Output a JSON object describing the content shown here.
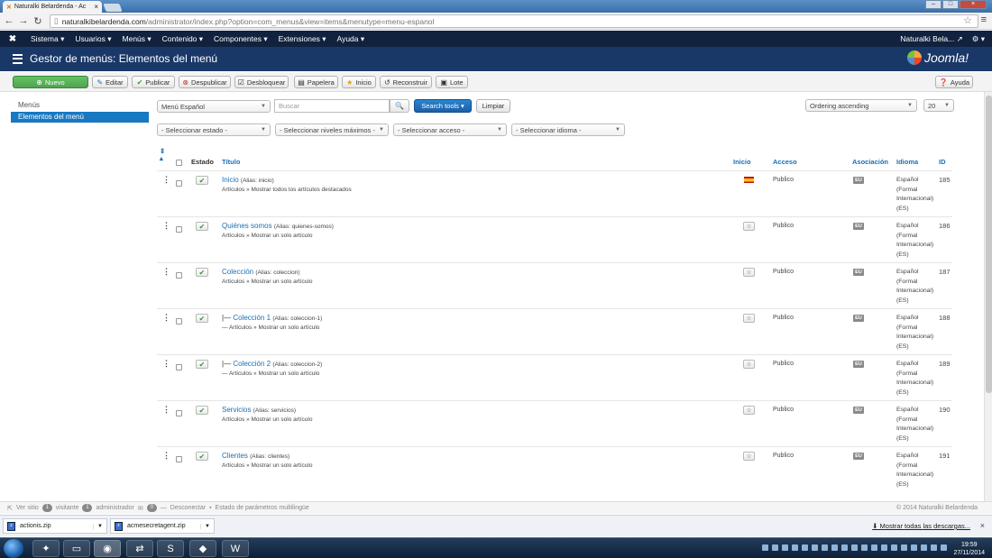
{
  "browser": {
    "tab_title": "Naturalki Belardenda - Ac",
    "url_host": "naturalkibelardenda.com",
    "url_path": "/administrator/index.php?option=com_menus&view=items&menutype=menu-espanol"
  },
  "navbar": {
    "items": [
      "Sistema ▾",
      "Usuarios ▾",
      "Menús ▾",
      "Contenido ▾",
      "Componentes ▾",
      "Extensiones ▾",
      "Ayuda ▾"
    ],
    "site_name": "Naturalki Bela...",
    "ext_icon": "↗",
    "gear": "⚙ ▾"
  },
  "header": {
    "title": "Gestor de menús: Elementos del menú",
    "brand": "Joomla!"
  },
  "toolbar": {
    "new": "Nuevo",
    "edit": "Editar",
    "publish": "Publicar",
    "unpublish": "Despublicar",
    "unlock": "Desbloquear",
    "trash": "Papelera",
    "home": "Inicio",
    "rebuild": "Reconstruir",
    "batch": "Lote",
    "help": "Ayuda"
  },
  "sidebar": {
    "heading": "Menús",
    "active": "Elementos del menú"
  },
  "filters": {
    "menu": "Menú Español",
    "search_placeholder": "Buscar",
    "search_tools": "Search tools ▾",
    "clear": "Limpiar",
    "ordering": "Ordering ascending",
    "limit": "20",
    "state": "- Seleccionar estado -",
    "levels": "- Seleccionar niveles máximos -",
    "access": "- Seleccionar acceso -",
    "language": "- Seleccionar idioma -"
  },
  "table": {
    "headers": {
      "estado": "Estado",
      "titulo": "Título",
      "inicio": "Inicio",
      "acceso": "Acceso",
      "asociacion": "Asociación",
      "idioma": "Idioma",
      "id": "ID"
    },
    "rows": [
      {
        "title": "Inicio",
        "prefix": "",
        "alias": "(Alias: inicio)",
        "type": "Artículos » Mostrar todos los artículos destacados",
        "access": "Publico",
        "assoc": "EU",
        "lang": [
          "Español",
          "(Formal",
          "Internacional)",
          "(ES)"
        ],
        "id": "185",
        "home": true
      },
      {
        "title": "Quiénes somos",
        "prefix": "",
        "alias": "(Alias: quienes-somos)",
        "type": "Artículos » Mostrar un solo artículo",
        "access": "Publico",
        "assoc": "EU",
        "lang": [
          "Español",
          "(Formal",
          "Internacional)",
          "(ES)"
        ],
        "id": "186",
        "home": false
      },
      {
        "title": "Colección",
        "prefix": "",
        "alias": "(Alias: coleccion)",
        "type": "Artículos » Mostrar un solo artículo",
        "access": "Publico",
        "assoc": "EU",
        "lang": [
          "Español",
          "(Formal",
          "Internacional)",
          "(ES)"
        ],
        "id": "187",
        "home": false
      },
      {
        "title": "Colección 1",
        "prefix": "|— ",
        "alias": "(Alias: coleccion-1)",
        "type": "— Artículos » Mostrar un solo artículo",
        "access": "Publico",
        "assoc": "EU",
        "lang": [
          "Español",
          "(Formal",
          "Internacional)",
          "(ES)"
        ],
        "id": "188",
        "home": false
      },
      {
        "title": "Colección 2",
        "prefix": "|— ",
        "alias": "(Alias: coleccion-2)",
        "type": "— Artículos » Mostrar un solo artículo",
        "access": "Publico",
        "assoc": "EU",
        "lang": [
          "Español",
          "(Formal",
          "Internacional)",
          "(ES)"
        ],
        "id": "189",
        "home": false
      },
      {
        "title": "Servicios",
        "prefix": "",
        "alias": "(Alias: servicios)",
        "type": "Artículos » Mostrar un solo artículo",
        "access": "Publico",
        "assoc": "EU",
        "lang": [
          "Español",
          "(Formal",
          "Internacional)",
          "(ES)"
        ],
        "id": "190",
        "home": false
      },
      {
        "title": "Clientes",
        "prefix": "",
        "alias": "(Alias: clientes)",
        "type": "Artículos » Mostrar un solo artículo",
        "access": "Publico",
        "assoc": "EU",
        "lang": [
          "Español",
          "(Formal",
          "Internacional)",
          "(ES)"
        ],
        "id": "191",
        "home": false
      }
    ]
  },
  "statusbar": {
    "view_site": "Ver sitio",
    "visitors_count": "1",
    "visitors": "visitante",
    "admins_count": "1",
    "admins": "administrador",
    "messages_count": "0",
    "logout": "Desconectar",
    "multilang": "Estado de parámetros multilingüe",
    "copyright": "© 2014 Naturalki Belardenda"
  },
  "downloads": {
    "files": [
      "actionis.zip",
      "acmesecretagent.zip"
    ],
    "show_all": "Mostrar todas las descargas..."
  },
  "taskbar": {
    "time": "19:59",
    "date": "27/11/2014"
  }
}
